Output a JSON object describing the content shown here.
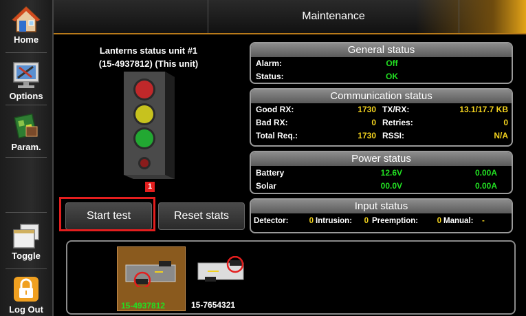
{
  "sidebar": {
    "items": [
      {
        "label": "Home",
        "icon": "home-icon"
      },
      {
        "label": "Options",
        "icon": "options-icon"
      },
      {
        "label": "Param.",
        "icon": "param-icon"
      },
      {
        "label": "Toggle",
        "icon": "toggle-icon"
      },
      {
        "label": "Log Out",
        "icon": "lock-icon"
      }
    ]
  },
  "header": {
    "title": "Maintenance"
  },
  "lantern": {
    "title_line1": "Lanterns status unit #1",
    "title_line2": "(15-4937812) (This unit)",
    "badge": "1",
    "lights": [
      "red",
      "yellow",
      "green",
      "small-red"
    ]
  },
  "buttons": {
    "start_test": "Start test",
    "reset_stats": "Reset stats"
  },
  "general": {
    "title": "General status",
    "alarm_label": "Alarm:",
    "alarm_value": "Off",
    "status_label": "Status:",
    "status_value": "OK"
  },
  "communication": {
    "title": "Communication status",
    "good_rx_label": "Good RX:",
    "good_rx_value": "1730",
    "tx_rx_label": "TX/RX:",
    "tx_rx_value": "13.1/17.7 KB",
    "bad_rx_label": "Bad RX:",
    "bad_rx_value": "0",
    "retries_label": "Retries:",
    "retries_value": "0",
    "total_req_label": "Total Req.:",
    "total_req_value": "1730",
    "rssi_label": "RSSI:",
    "rssi_value": "N/A"
  },
  "power": {
    "title": "Power status",
    "battery_label": "Battery",
    "battery_voltage": "12.6V",
    "battery_current": "0.00A",
    "solar_label": "Solar",
    "solar_voltage": "00.0V",
    "solar_current": "0.00A"
  },
  "input": {
    "title": "Input status",
    "detector_label": "Detector:",
    "detector_value": "0",
    "intrusion_label": "Intrusion:",
    "intrusion_value": "0",
    "preemption_label": "Preemption:",
    "preemption_value": "0",
    "manual_label": "Manual:",
    "manual_value": "-"
  },
  "devices": [
    {
      "id": "15-4937812",
      "selected": true
    },
    {
      "id": "15-7654321",
      "selected": false
    }
  ],
  "colors": {
    "accent": "#e2a317",
    "highlight": "#e41e1e",
    "value_green": "#22e022",
    "value_yellow": "#f2d21e",
    "selected_device": "#8a5a1e"
  }
}
